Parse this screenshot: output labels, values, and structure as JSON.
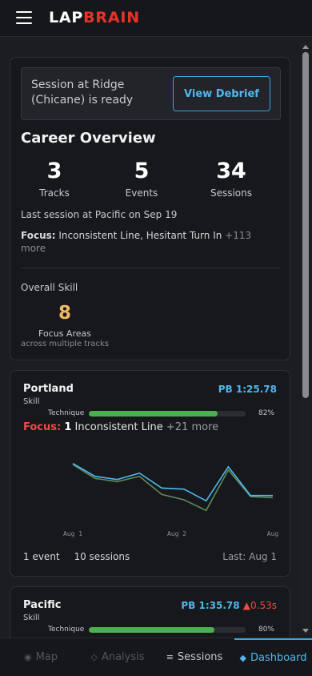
{
  "header": {
    "logo_part1": "LAP",
    "logo_part2": "BRAIN"
  },
  "notice": {
    "text": "Session at Ridge (Chicane) is ready",
    "button": "View Debrief"
  },
  "career": {
    "title": "Career Overview",
    "stats": [
      {
        "value": "3",
        "label": "Tracks"
      },
      {
        "value": "5",
        "label": "Events"
      },
      {
        "value": "34",
        "label": "Sessions"
      }
    ],
    "last_session": "Last session at Pacific on Sep 19",
    "focus_label": "Focus:",
    "focus_text": "Inconsistent Line, Hesitant Turn In",
    "focus_more": "+113 more",
    "overall_label": "Overall Skill",
    "focus_areas_value": "8",
    "focus_areas_label": "Focus Areas",
    "focus_areas_sub": "across multiple tracks"
  },
  "tracks": [
    {
      "name": "Portland",
      "pb": "PB 1:25.78",
      "delta": "",
      "skill_label": "Skill",
      "technique_label": "Technique",
      "technique_pct": "82%",
      "technique_value": 0.82,
      "focus_label": "Focus:",
      "focus_count": "1",
      "focus_text": "Inconsistent Line",
      "focus_more": "+21 more",
      "events": "1 event",
      "sessions": "10 sessions",
      "last": "Last: Aug 1",
      "x_ticks": [
        "Aug  1",
        "Aug  2",
        "Aug"
      ]
    },
    {
      "name": "Pacific",
      "pb": "PB 1:35.78",
      "delta": "▲0.53s",
      "skill_label": "Skill",
      "technique_label": "Technique",
      "technique_pct": "80%",
      "technique_value": 0.8
    }
  ],
  "chart_data": {
    "type": "line",
    "x": [
      1,
      2,
      3,
      4,
      5,
      6,
      7,
      8,
      9,
      10,
      11
    ],
    "x_tick_labels": [
      "Aug  1",
      "Aug  2",
      "Aug"
    ],
    "series": [
      {
        "values": [
          92,
          80,
          77,
          83,
          69,
          68,
          57,
          89,
          62,
          62
        ],
        "color": "#4db8ef"
      },
      {
        "values": [
          91,
          78,
          75,
          80,
          63,
          58,
          48,
          86,
          61,
          60
        ],
        "color": "#5f8a5c"
      }
    ],
    "ylim": [
      40,
      100
    ],
    "grid": false
  },
  "nav": {
    "items": [
      {
        "icon": "◉",
        "label": "Map"
      },
      {
        "icon": "◇",
        "label": "Analysis"
      },
      {
        "icon": "≡",
        "label": "Sessions"
      },
      {
        "icon": "◆",
        "label": "Dashboard"
      }
    ]
  },
  "colors": {
    "accent": "#4db8ef",
    "brand_red": "#e8322c",
    "focus_orange": "#f0b860",
    "bar_green": "#4bb04f"
  }
}
